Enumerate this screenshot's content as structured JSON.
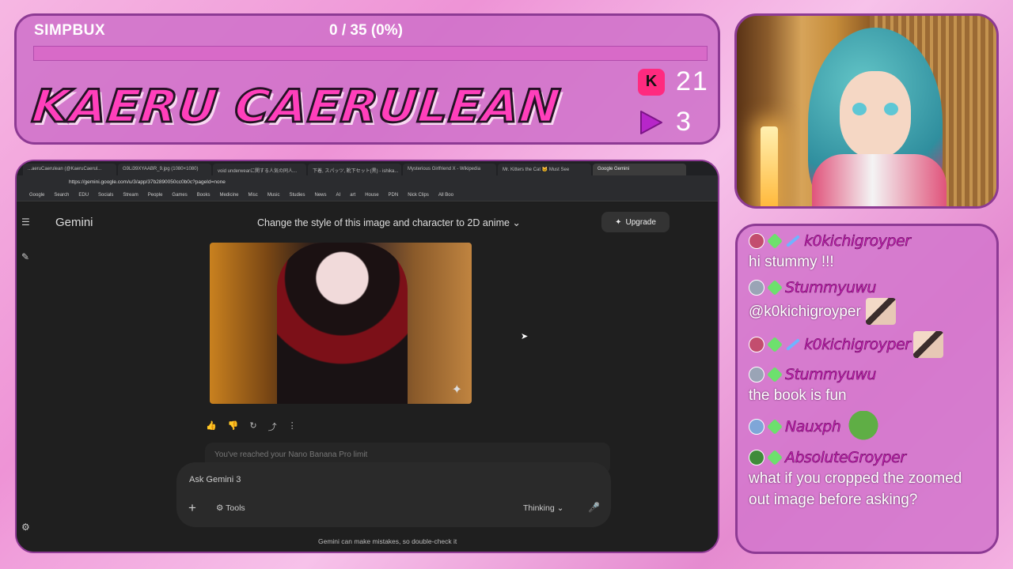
{
  "overlay": {
    "simpbux_label": "SIMPBUX",
    "simpbux_progress_text": "0 / 35 (0%)",
    "simpbux_progress": 0,
    "streamer_name": "KAERU CAERULEAN",
    "stat_k_icon": "K",
    "stat_k_count": "21",
    "stat_play_count": "3",
    "colors": {
      "accent": "#ff3fbb",
      "border": "#8d3a94"
    }
  },
  "chat": [
    {
      "user": "k0kichigroyper",
      "badges": [
        "avatar-red",
        "diamond",
        "sword"
      ],
      "text": "hi stummy !!!"
    },
    {
      "user": "Stummyuwu",
      "badges": [
        "avatar-gray",
        "diamond"
      ],
      "text": "@k0kichigroyper",
      "emote": "anime-emote"
    },
    {
      "user": "k0kichigroyper",
      "badges": [
        "avatar-red",
        "diamond",
        "sword"
      ],
      "text": "",
      "emote_after_name": "anime-emote"
    },
    {
      "user": "Stummyuwu",
      "badges": [
        "avatar-gray",
        "diamond"
      ],
      "text": "the book is fun"
    },
    {
      "user": "Nauxph",
      "badges": [
        "avatar-blue",
        "diamond"
      ],
      "text": "",
      "emote_after_name": "pepe-emote"
    },
    {
      "user": "AbsoluteGroyper",
      "badges": [
        "avatar-green",
        "diamond"
      ],
      "text": "what if you cropped the zoomed out image before asking?"
    }
  ],
  "browser": {
    "tabs": [
      "...aeruCaerulean (@KaeruCaerul...",
      "G9Li39XYAABR_9.jpg (1080×1080)",
      "void underwearに関する人気の同人...",
      "下着, スパッツ, 靴下セット(黒) - ishika...",
      "Mysterious Girlfriend X - Wikipedia",
      "Mr. Kitters the Cat 🐱 Must See",
      "Google Gemini"
    ],
    "url": "https://gemini.google.com/u/3/app/37b2890050cc0b0c?pageId=none",
    "bookmarks": [
      "Google",
      "Search",
      "EDU",
      "Socials",
      "Stream",
      "People",
      "Games",
      "Books",
      "Medicine",
      "Misc",
      "Music",
      "Studies",
      "News",
      "AI",
      "art",
      "House",
      "PDN",
      "Nick Clips",
      "All Boo"
    ],
    "app_name": "Gemini",
    "conversation_title": "Change the style of this image and character to 2D anime",
    "upgrade_label": "Upgrade",
    "limit_notice": "You've reached your Nano Banana Pro limit",
    "input_placeholder": "Ask Gemini 3",
    "tools_label": "Tools",
    "mode_label": "Thinking",
    "disclaimer": "Gemini can make mistakes, so double-check it"
  }
}
